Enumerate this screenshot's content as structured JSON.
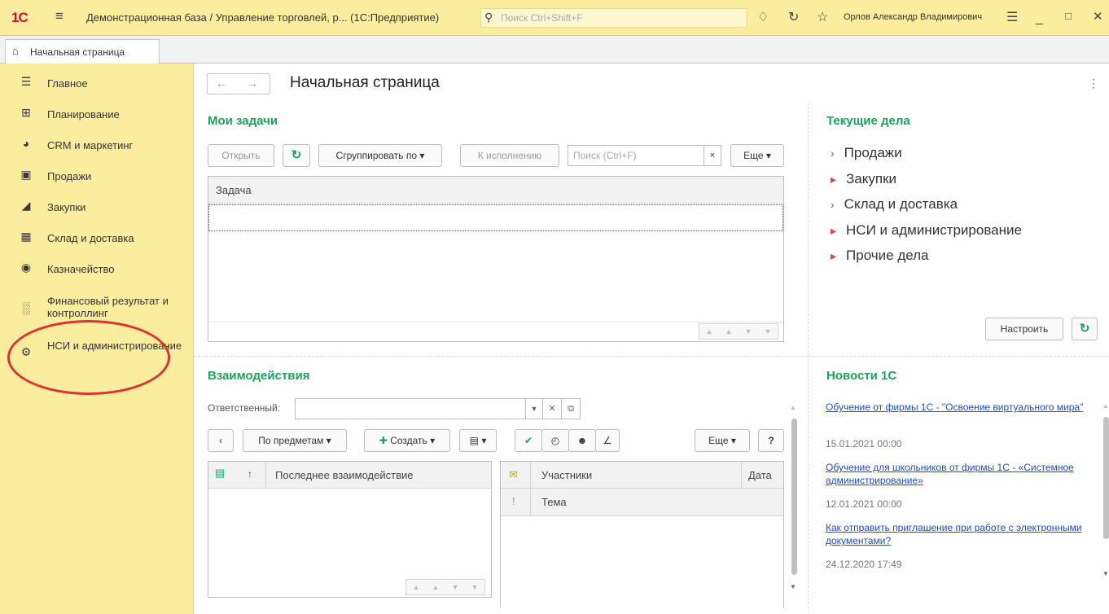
{
  "titlebar": {
    "logo": "1С",
    "title": "Демонстрационная база / Управление торговлей, р...  (1С:Предприятие)",
    "search_placeholder": "Поиск Ctrl+Shift+F",
    "user": "Орлов Александр Владимирович"
  },
  "tabs": {
    "home_label": "Начальная страница"
  },
  "sidebar": {
    "items": [
      {
        "label": "Главное",
        "icon": "menu-lines-icon"
      },
      {
        "label": "Планирование",
        "icon": "planning-icon"
      },
      {
        "label": "CRM и маркетинг",
        "icon": "pie-chart-icon"
      },
      {
        "label": "Продажи",
        "icon": "shopping-bag-icon"
      },
      {
        "label": "Закупки",
        "icon": "cart-icon"
      },
      {
        "label": "Склад и доставка",
        "icon": "warehouse-icon"
      },
      {
        "label": "Казначейство",
        "icon": "coin-icon"
      },
      {
        "label": "Финансовый результат и контроллинг",
        "icon": "bar-chart-icon"
      },
      {
        "label": "НСИ и администрирование",
        "icon": "gear-icon"
      }
    ]
  },
  "page": {
    "title": "Начальная страница"
  },
  "tasks": {
    "title": "Мои задачи",
    "open": "Открыть",
    "group_by": "Сгруппировать по",
    "to_execute": "К исполнению",
    "search_placeholder": "Поиск (Ctrl+F)",
    "clear": "×",
    "more": "Еще",
    "column": "Задача"
  },
  "current": {
    "title": "Текущие дела",
    "items": [
      {
        "label": "Продажи",
        "expanded_marker": "›"
      },
      {
        "label": "Закупки",
        "expanded_marker": "▸"
      },
      {
        "label": "Склад и доставка",
        "expanded_marker": "›"
      },
      {
        "label": "НСИ и администрирование",
        "expanded_marker": "▸"
      },
      {
        "label": "Прочие дела",
        "expanded_marker": "▸"
      }
    ],
    "configure": "Настроить"
  },
  "interactions": {
    "title": "Взаимодействия",
    "responsible_label": "Ответственный:",
    "by_subjects": "По предметам",
    "create": "Создать",
    "more": "Еще",
    "help": "?",
    "left_columns": [
      "↑",
      "Последнее взаимодействие"
    ],
    "right_columns": [
      "Участники",
      "Дата"
    ],
    "right_row": "Тема"
  },
  "news": {
    "title": "Новости 1С",
    "items": [
      {
        "link": "Обучение от фирмы 1С - \"Освоение виртуального мира\"",
        "date": "15.01.2021 00:00"
      },
      {
        "link": "Обучение для школьников от фирмы 1С - «Системное администрирование»",
        "date": "12.01.2021 00:00"
      },
      {
        "link": "Как отправить приглашение при работе с электронными документами?",
        "date": "24.12.2020 17:49"
      }
    ]
  },
  "colors": {
    "accent_green": "#20a060",
    "sidebar_bg": "#fbed9e",
    "brand_red": "#c8102e",
    "highlight_oval": "#e03030"
  }
}
